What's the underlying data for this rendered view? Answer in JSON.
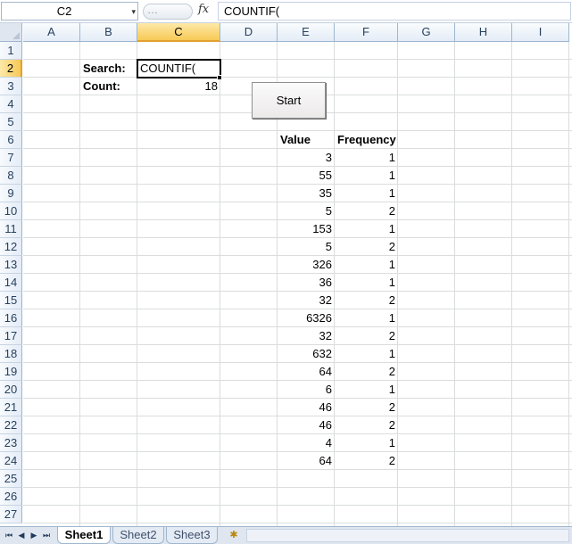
{
  "formula_bar": {
    "name_box": "C2",
    "name_box_arrow": "▾",
    "handle_dots": "…",
    "fx": "fx",
    "formula": "COUNTIF("
  },
  "columns": [
    "A",
    "B",
    "C",
    "D",
    "E",
    "F",
    "G",
    "H",
    "I"
  ],
  "rows": [
    "1",
    "2",
    "3",
    "4",
    "5",
    "6",
    "7",
    "8",
    "9",
    "10",
    "11",
    "12",
    "13",
    "14",
    "15",
    "16",
    "17",
    "18",
    "19",
    "20",
    "21",
    "22",
    "23",
    "24",
    "25",
    "26",
    "27"
  ],
  "selection": {
    "column": "C",
    "row": "2"
  },
  "cells": {
    "search_label": "Search:",
    "search_value": "COUNTIF(",
    "count_label": "Count:",
    "count_value": "18"
  },
  "table": {
    "headers": [
      "Value",
      "Frequency"
    ],
    "rows": [
      [
        "3",
        "1"
      ],
      [
        "55",
        "1"
      ],
      [
        "35",
        "1"
      ],
      [
        "5",
        "2"
      ],
      [
        "153",
        "1"
      ],
      [
        "5",
        "2"
      ],
      [
        "326",
        "1"
      ],
      [
        "36",
        "1"
      ],
      [
        "32",
        "2"
      ],
      [
        "6326",
        "1"
      ],
      [
        "32",
        "2"
      ],
      [
        "632",
        "1"
      ],
      [
        "64",
        "2"
      ],
      [
        "6",
        "1"
      ],
      [
        "46",
        "2"
      ],
      [
        "46",
        "2"
      ],
      [
        "4",
        "1"
      ],
      [
        "64",
        "2"
      ]
    ]
  },
  "start_button": "Start",
  "sheet_nav": [
    "⏮",
    "◀",
    "▶",
    "⏭"
  ],
  "sheets": [
    "Sheet1",
    "Sheet2",
    "Sheet3"
  ],
  "active_sheet": "Sheet1",
  "insert_sheet_icon": "✱"
}
